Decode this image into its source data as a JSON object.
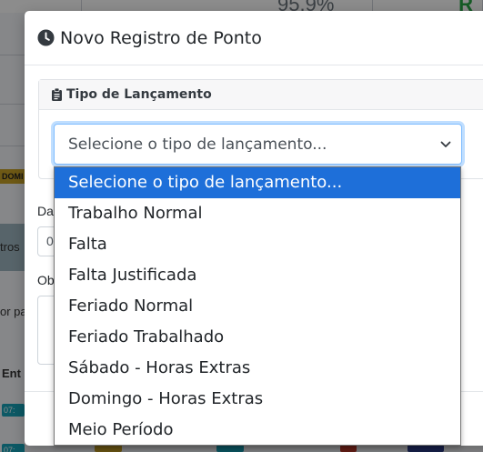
{
  "background": {
    "stat_primary": "95.9%",
    "stat_secondary": "R",
    "left_badge": "DOMI",
    "left_frag_1": "tros",
    "left_frag_2": "or pa",
    "left_frag_3": "Ent",
    "time_badge_1": "07:",
    "time_badge_2": "07:"
  },
  "modal": {
    "title": "Novo Registro de Ponto",
    "title_icon": "clock-icon",
    "card": {
      "title": "Tipo de Lançamento",
      "title_icon": "clipboard-icon",
      "select": {
        "value": "Selecione o tipo de lançamento...",
        "icon": "chevron-down-icon"
      }
    },
    "fields": {
      "date_label_frag": "Da",
      "date_value_frag": "0",
      "obs_label_frag": "Ob"
    }
  },
  "dropdown": {
    "options": [
      {
        "label": "Selecione o tipo de lançamento...",
        "selected": true
      },
      {
        "label": "Trabalho Normal",
        "selected": false
      },
      {
        "label": "Falta",
        "selected": false
      },
      {
        "label": "Falta Justificada",
        "selected": false
      },
      {
        "label": "Feriado Normal",
        "selected": false
      },
      {
        "label": "Feriado Trabalhado",
        "selected": false
      },
      {
        "label": "Sábado - Horas Extras",
        "selected": false
      },
      {
        "label": "Domingo - Horas Extras",
        "selected": false
      },
      {
        "label": "Meio Período",
        "selected": false
      }
    ]
  },
  "colors": {
    "selected_option": "#1e6fd9",
    "focus_border": "#80bdff",
    "overlay": "rgba(0,0,0,0.45)"
  }
}
